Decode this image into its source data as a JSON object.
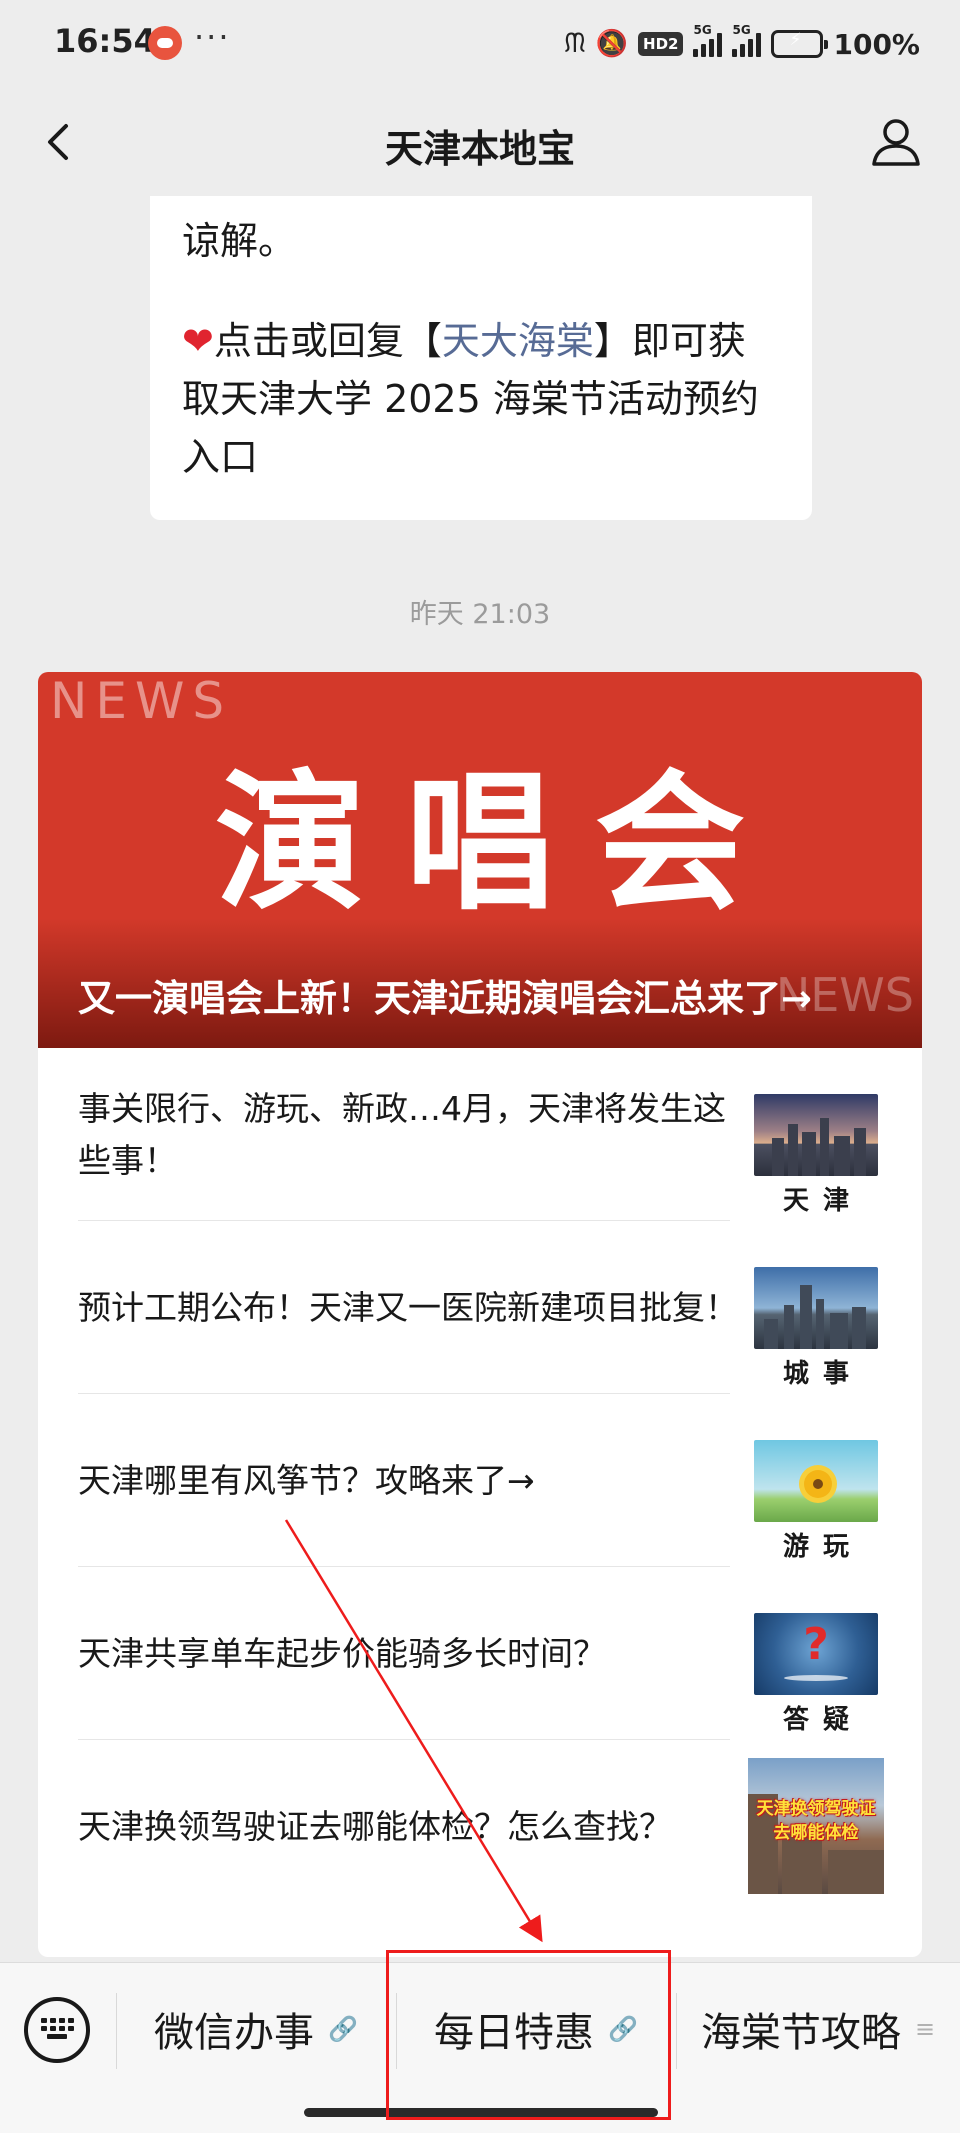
{
  "status_bar": {
    "time": "16:54",
    "more": "···",
    "hd_badge": "HD2",
    "net1": "5G",
    "net2": "5G",
    "battery": "100%",
    "battery_level": 1.0
  },
  "header": {
    "title": "天津本地宝"
  },
  "message": {
    "line_top": "谅解。",
    "line_1_pre": "点击或回复【",
    "keyword": "天大海棠",
    "line_1_post": "】即可获",
    "line_2": "取天津大学 2025 海棠节活动预约",
    "line_3": "入口"
  },
  "chat_time": "昨天 21:03",
  "article": {
    "cover_watermark": "NEWS",
    "cover_big_text": "演唱会",
    "cover_watermark_2": "NEWS",
    "cover_title": "又一演唱会上新！天津近期演唱会汇总来了→",
    "items": [
      {
        "title": "事关限行、游玩、新政…4月，天津将发生这些事！",
        "thumb_label": "天津"
      },
      {
        "title": "预计工期公布！天津又一医院新建项目批复！",
        "thumb_label": "城事"
      },
      {
        "title": "天津哪里有风筝节？攻略来了→",
        "thumb_label": "游玩"
      },
      {
        "title": "天津共享单车起步价能骑多长时间？",
        "thumb_label": "答疑"
      },
      {
        "title": "天津换领驾驶证去哪能体检？怎么查找？",
        "thumb_caption_1": "天津换领驾驶证",
        "thumb_caption_2": "去哪能体检"
      }
    ]
  },
  "bottom_menu": {
    "items": [
      {
        "label": "微信办事",
        "icon": "link-icon"
      },
      {
        "label": "每日特惠",
        "icon": "link-icon"
      },
      {
        "label": "海棠节攻略",
        "icon": "menu-list-icon"
      }
    ]
  },
  "colors": {
    "background": "#ededed",
    "cover_red": "#d3392a",
    "link_blue": "#576b95",
    "annotation_red": "#ee1c1c"
  }
}
